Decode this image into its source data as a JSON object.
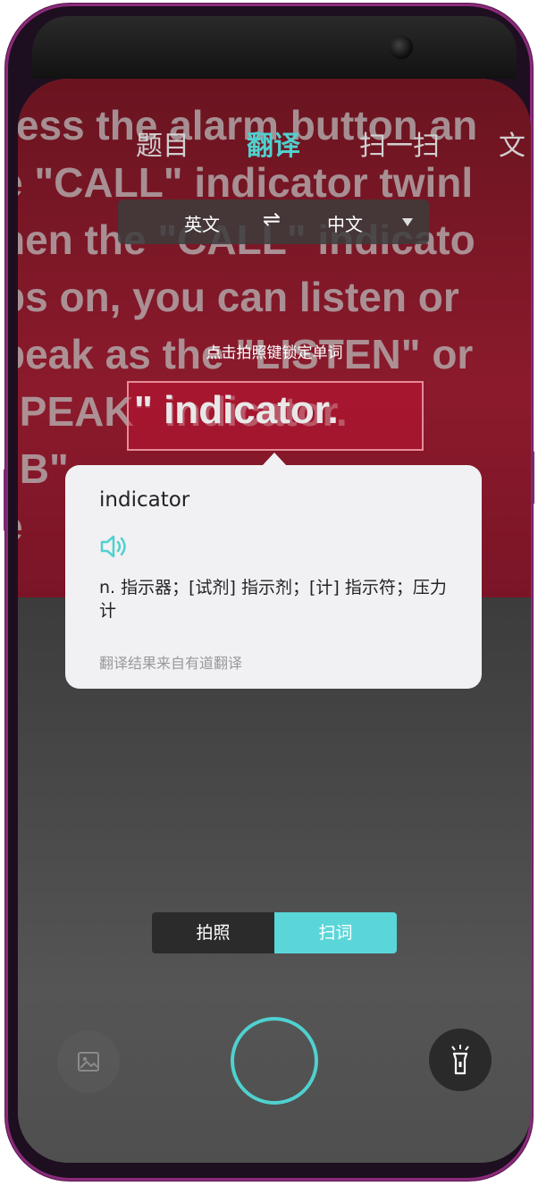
{
  "tabs": [
    {
      "label": "题目",
      "active": false
    },
    {
      "label": "翻译",
      "active": true
    },
    {
      "label": "扫一扫",
      "active": false
    },
    {
      "label": "文",
      "active": false
    }
  ],
  "language": {
    "source": "英文",
    "swap_icon": "swap-icon",
    "target": "中文"
  },
  "camera_text": [
    "ress the alarm button an",
    "e \"CALL\" indicator twinl",
    "hen the \"CALL\" indicato",
    "ps on, you can listen or",
    "peak as the \"LISTEN\" or",
    "\"PEAK\" indicator.",
    "\"B\"",
    "e"
  ],
  "hint": "点击拍照键锁定单词",
  "focus_word": "\" indicator.",
  "result": {
    "word": "indicator",
    "definition": "n. 指示器；[试剂] 指示剂；[计] 指示符；压力计",
    "source": "翻译结果来自有道翻译"
  },
  "mode": {
    "photo_label": "拍照",
    "scan_label": "扫词",
    "selected": "scan"
  },
  "colors": {
    "accent": "#4fd1cf",
    "scan_button": "#5ad6d8"
  }
}
